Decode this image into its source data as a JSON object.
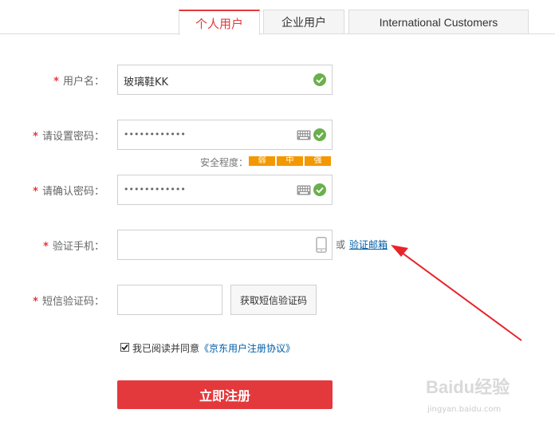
{
  "tabs": [
    {
      "label": "个人用户",
      "active": true
    },
    {
      "label": "企业用户",
      "active": false
    },
    {
      "label": "International Customers",
      "active": false
    }
  ],
  "form": {
    "username": {
      "label": "用户名：",
      "value": "玻璃鞋KK"
    },
    "password": {
      "label": "请设置密码：",
      "value": "••••••••••••"
    },
    "strength": {
      "label": "安全程度：",
      "levels": [
        "弱",
        "中",
        "强"
      ]
    },
    "confirm": {
      "label": "请确认密码：",
      "value": "••••••••••••"
    },
    "phone": {
      "label": "验证手机：",
      "or_text": "或",
      "email_link": "验证邮箱"
    },
    "sms": {
      "label": "短信验证码：",
      "button": "获取短信验证码"
    },
    "agreement": {
      "text": "我已阅读并同意",
      "link": "《京东用户注册协议》",
      "checked": true
    },
    "submit": "立即注册",
    "required_mark": "*"
  },
  "watermark": {
    "main": "Baidu经验",
    "sub": "jingyan.baidu.com"
  },
  "colors": {
    "accent": "#e4393c",
    "strength": "#f39800",
    "link": "#005ea7",
    "check": "#6ab04c"
  }
}
